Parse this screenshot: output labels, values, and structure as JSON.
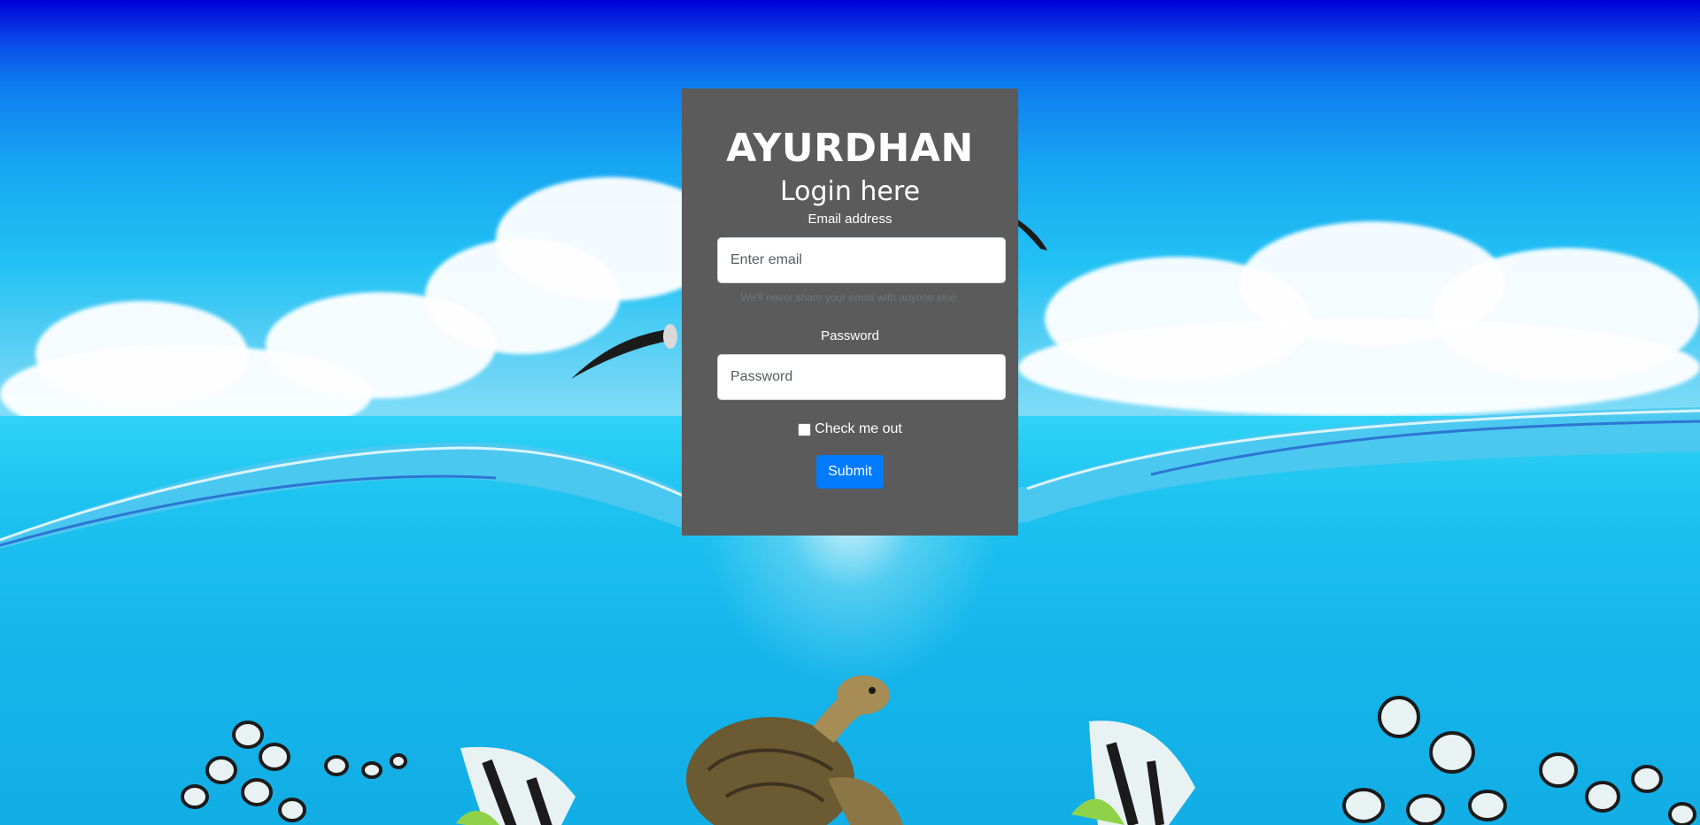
{
  "brand": "AYURDHAN",
  "subtitle": "Login here",
  "email": {
    "label": "Email address",
    "placeholder": "Enter email",
    "value": "",
    "help": "We'll never share your email with anyone else."
  },
  "password": {
    "label": "Password",
    "placeholder": "Password",
    "value": ""
  },
  "remember": {
    "label": "Check me out",
    "checked": false
  },
  "submit_label": "Submit",
  "colors": {
    "card_bg": "#5b5b5b",
    "primary_button": "#007bff",
    "text": "#ffffff"
  },
  "background_image": "underwater-ocean-scene-with-turtle-fish-birds"
}
